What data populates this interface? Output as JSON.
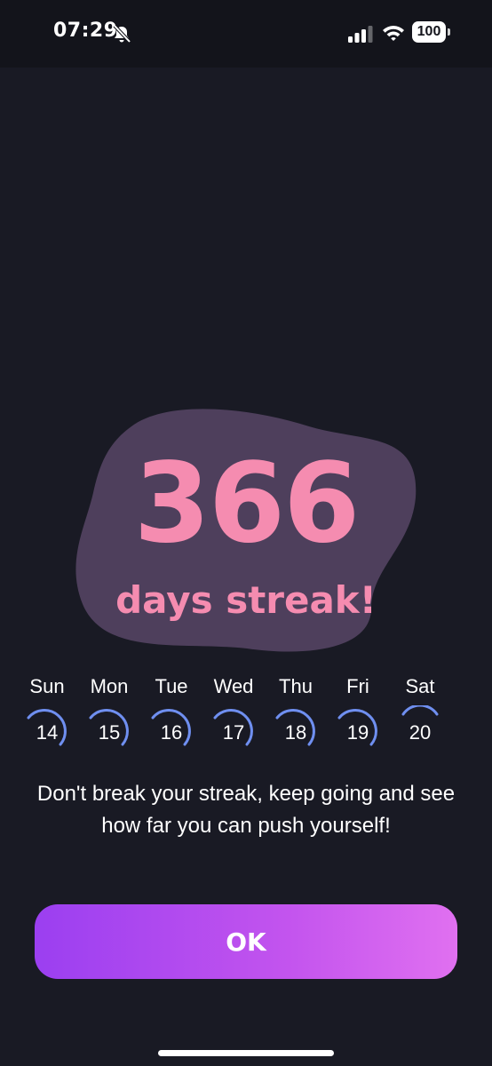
{
  "status_bar": {
    "time": "07:29",
    "battery_level": "100"
  },
  "streak": {
    "count": "366",
    "label": "days streak!"
  },
  "week": [
    {
      "day": "Sun",
      "date": "14"
    },
    {
      "day": "Mon",
      "date": "15"
    },
    {
      "day": "Tue",
      "date": "16"
    },
    {
      "day": "Wed",
      "date": "17"
    },
    {
      "day": "Thu",
      "date": "18"
    },
    {
      "day": "Fri",
      "date": "19"
    },
    {
      "day": "Sat",
      "date": "20"
    }
  ],
  "message": "Don't break your streak, keep going and see how far you can push yourself!",
  "ok_button": {
    "label": "OK"
  },
  "colors": {
    "background": "#191a24",
    "accent_pink": "#f58cb0",
    "blob": "#4e3f5c",
    "ring": "#6f8ff0",
    "button_start": "#9b3ff0",
    "button_end": "#e070f0"
  }
}
